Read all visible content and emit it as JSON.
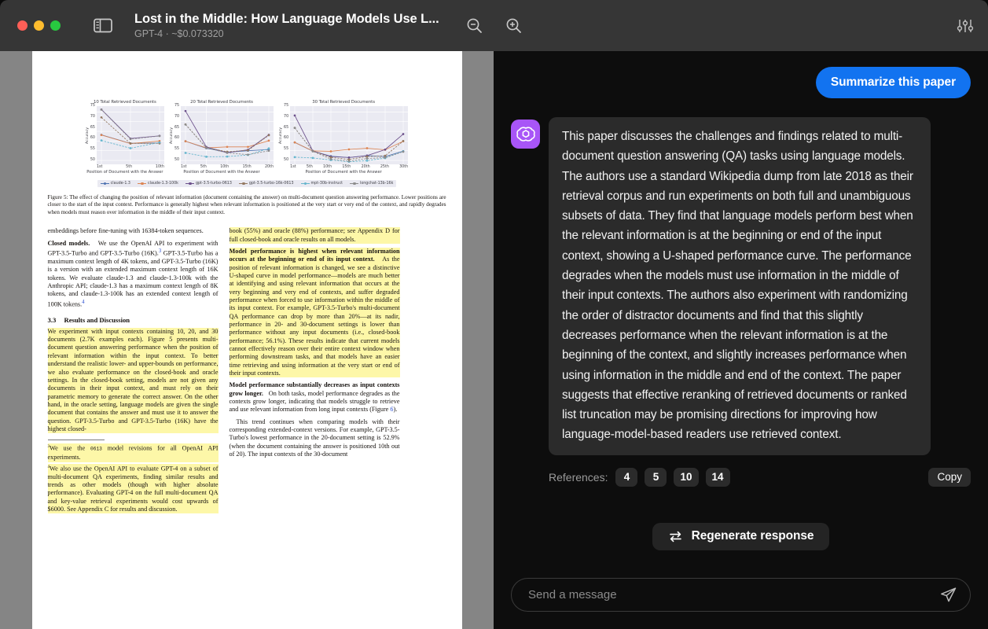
{
  "window": {
    "title": "Lost in the Middle: How Language Models Use L...",
    "subtitle": "GPT-4 · ~$0.073320",
    "traffic_close": "close",
    "traffic_minimize": "minimize",
    "traffic_zoom": "zoom",
    "sidebar_toggle_icon": "sidebar-toggle-icon",
    "zoom_out_icon": "zoom-out-icon",
    "zoom_in_icon": "zoom-in-icon",
    "settings_icon": "sliders-icon",
    "accent_blue": "#1273f0",
    "avatar_purple": "#a855f7"
  },
  "pdf": {
    "figure": {
      "caption": "Figure 5: The effect of changing the position of relevant information (document containing the answer) on multi-document question answering performance. Lower positions are closer to the start of the input context. Performance is generally highest when relevant information is positioned at the very start or very end of the context, and rapidly degrades when models must reason over information in the middle of their input context."
    },
    "left_column": {
      "p1": "embeddings before fine-tuning with 16384-token sequences.",
      "p2_head": "Closed models.",
      "p2": "We use the OpenAI API to experiment with GPT-3.5-Turbo and GPT-3.5-Turbo (16K).",
      "p2_sup": "3",
      "p2b": "GPT-3.5-Turbo has a maximum context length of 4K tokens, and GPT-3.5-Turbo (16K) is a version with an extended maximum context length of 16K tokens. We evaluate claude-1.3 and claude-1.3-100k with the Anthropic API; claude-1.3 has a maximum context length of 8K tokens, and claude-1.3-100k has an extended context length of 100K tokens.",
      "p2_sup2": "4",
      "section_num": "3.3",
      "section_title": "Results and Discussion",
      "p3": "We experiment with input contexts containing 10, 20, and 30 documents (2.7K examples each). Figure 5 presents multi-document question answering performance when the position of relevant information within the input context. To better understand the realistic lower- and upper-bounds on performance, we also evaluate performance on the closed-book and oracle settings. In the closed-book setting, models are not given any documents in their input context, and must rely on their parametric memory to generate the correct answer. On the other hand, in the oracle setting, language models are given the single document that contains the answer and must use it to answer the question. GPT-3.5-Turbo and GPT-3.5-Turbo (16K) have the highest closed-",
      "footnote3_sup": "3",
      "footnote3_a": "We use the ",
      "footnote3_mono": "0613",
      "footnote3_b": " model revisions for all OpenAI API experiments.",
      "footnote4_sup": "4",
      "footnote4": "We also use the OpenAI API to evaluate GPT-4 on a subset of multi-document QA experiments, finding similar results and trends as other models (though with higher absolute performance). Evaluating GPT-4 on the full multi-document QA and key-value retrieval experiments would cost upwards of $6000. See Appendix C for results and discussion."
    },
    "right_column": {
      "p1": "book (55%) and oracle (88%) performance; see Appendix D for full closed-book and oracle results on all models.",
      "p2_head": "Model performance is highest when relevant information occurs at the beginning or end of its input context.",
      "p2": "As the position of relevant information is changed, we see a distinctive U-shaped curve in model performance—models are much better at identifying and using relevant information that occurs at the very beginning and very end of contexts, and suffer degraded performance when forced to use information within the middle of its input context. For example, GPT-3.5-Turbo's multi-document QA performance can drop by more than 20%—at its nadir, performance in 20- and 30-document settings is lower than performance without any input documents (i.e., closed-book performance; 56.1%). These results indicate that current models cannot effectively reason over their entire context window when performing downstream tasks, and that models have an easier time retrieving and using information at the very start or end of their input contexts.",
      "p3_head": "Model performance substantially decreases as input contexts grow longer.",
      "p3": "On both tasks, model performance degrades as the contexts grow longer, indicating that models struggle to retrieve and use relevant information from long input contexts (Figure ",
      "p3_ref": "6",
      "p3_end": ").",
      "p4": "This trend continues when comparing models with their corresponding extended-context versions. For example, GPT-3.5-Turbo's lowest performance in the 20-document setting is 52.9% (when the document containing the answer is positioned 10th out of 20). The input contexts of the 30-document"
    }
  },
  "chart_data": [
    {
      "type": "line",
      "title": "10 Total Retrieved Documents",
      "xlabel": "Position of Document with the Answer",
      "ylabel": "Accuracy",
      "categories": [
        "1st",
        "5th",
        "10th"
      ],
      "ylim": [
        48,
        78
      ],
      "yticks": [
        50,
        55,
        60,
        65,
        70,
        75
      ],
      "grid": true,
      "series": [
        {
          "name": "claude-1.3",
          "color": "#4c72b0",
          "dash": false,
          "values": [
            63.2,
            58.8,
            59.0
          ]
        },
        {
          "name": "claude-1.3-100k",
          "color": "#dd8452",
          "dash": false,
          "values": [
            63.1,
            58.7,
            60.0
          ]
        },
        {
          "name": "gpt-3.5-turbo-0613",
          "color": "#6b4f8a",
          "dash": false,
          "values": [
            76.3,
            61.3,
            62.7
          ]
        },
        {
          "name": "gpt-3.5-turbo-16k-0613",
          "color": "#937860",
          "dash": true,
          "values": [
            72.2,
            58.8,
            58.8
          ]
        },
        {
          "name": "mpt-30b-instruct",
          "color": "#64b5cd",
          "dash": true,
          "values": [
            60.3,
            56.3,
            59.3
          ]
        },
        {
          "name": "longchat-13b-16k",
          "color": "#8c8c8c",
          "dash": true,
          "values": [
            76.2,
            61.0,
            62.6
          ]
        }
      ]
    },
    {
      "type": "line",
      "title": "20 Total Retrieved Documents",
      "xlabel": "Position of Document with the Answer",
      "ylabel": "Accuracy",
      "categories": [
        "1st",
        "5th",
        "10th",
        "15th",
        "20th"
      ],
      "ylim": [
        48,
        78
      ],
      "yticks": [
        50,
        55,
        60,
        65,
        70,
        75
      ],
      "grid": true,
      "series": [
        {
          "name": "claude-1.3",
          "color": "#4c72b0",
          "dash": false,
          "values": [
            59.9,
            56.3,
            54.2,
            55.0,
            55.6
          ]
        },
        {
          "name": "claude-1.3-100k",
          "color": "#dd8452",
          "dash": false,
          "values": [
            59.9,
            56.5,
            57.0,
            57.0,
            60.2
          ]
        },
        {
          "name": "gpt-3.5-turbo-0613",
          "color": "#6b4f8a",
          "dash": false,
          "values": [
            75.5,
            57.0,
            54.0,
            55.5,
            63.2
          ]
        },
        {
          "name": "gpt-3.5-turbo-16k-0613",
          "color": "#937860",
          "dash": true,
          "values": [
            68.6,
            56.6,
            54.5,
            55.2,
            63.0
          ]
        },
        {
          "name": "mpt-30b-instruct",
          "color": "#64b5cd",
          "dash": true,
          "values": [
            53.9,
            51.9,
            52.0,
            52.8,
            56.2
          ]
        },
        {
          "name": "longchat-13b-16k",
          "color": "#8c8c8c",
          "dash": true,
          "values": [
            68.5,
            56.5,
            53.9,
            53.0,
            55.0
          ]
        }
      ]
    },
    {
      "type": "line",
      "title": "30 Total Retrieved Documents",
      "xlabel": "Position of Document with the Answer",
      "ylabel": "Accuracy",
      "categories": [
        "1st",
        "5th",
        "10th",
        "15th",
        "20th",
        "25th",
        "30th"
      ],
      "ylim": [
        48,
        78
      ],
      "yticks": [
        50,
        55,
        60,
        65,
        70,
        75
      ],
      "grid": true,
      "series": [
        {
          "name": "claude-1.3",
          "color": "#4c72b0",
          "dash": false,
          "values": [
            59.3,
            54.8,
            52.2,
            51.5,
            52.5,
            52.0,
            54.8
          ]
        },
        {
          "name": "claude-1.3-100k",
          "color": "#dd8452",
          "dash": false,
          "values": [
            59.3,
            54.9,
            54.7,
            55.7,
            56.3,
            55.5,
            59.9
          ]
        },
        {
          "name": "gpt-3.5-turbo-0613",
          "color": "#6b4f8a",
          "dash": false,
          "values": [
            73.2,
            54.9,
            52.0,
            51.5,
            52.5,
            55.6,
            63.6
          ]
        },
        {
          "name": "gpt-3.5-turbo-16k-0613",
          "color": "#937860",
          "dash": true,
          "values": [
            66.8,
            54.8,
            51.6,
            50.5,
            52.0,
            52.4,
            60.0
          ]
        },
        {
          "name": "mpt-30b-instruct",
          "color": "#64b5cd",
          "dash": true,
          "values": [
            51.7,
            51.3,
            50.2,
            49.3,
            49.9,
            51.2,
            54.7
          ]
        },
        {
          "name": "longchat-13b-16k",
          "color": "#8c8c8c",
          "dash": true,
          "values": [
            66.8,
            54.7,
            50.7,
            49.6,
            51.0,
            51.5,
            54.5
          ]
        }
      ]
    }
  ],
  "chat": {
    "user_message": "Summarize this paper",
    "assistant_message": "This paper discusses the challenges and findings related to multi-document question answering (QA) tasks using language models. The authors use a standard Wikipedia dump from late 2018 as their retrieval corpus and run experiments on both full and unambiguous subsets of data. They find that language models perform best when the relevant information is at the beginning or end of the input context, showing a U-shaped performance curve. The performance degrades when the models must use information in the middle of their input contexts. The authors also experiment with randomizing the order of distractor documents and find that this slightly decreases performance when the relevant information is at the beginning of the context, and slightly increases performance when using information in the middle and end of the context. The paper suggests that effective reranking of retrieved documents or ranked list truncation may be promising directions for improving how language-model-based readers use retrieved context.",
    "references_label": "References:",
    "references": [
      "4",
      "5",
      "10",
      "14"
    ],
    "copy_label": "Copy",
    "regenerate_label": "Regenerate response",
    "regenerate_icon": "regenerate-icon",
    "avatar_icon": "openai-logo-icon",
    "composer_placeholder": "Send a message",
    "composer_value": "",
    "send_icon": "send-icon"
  }
}
